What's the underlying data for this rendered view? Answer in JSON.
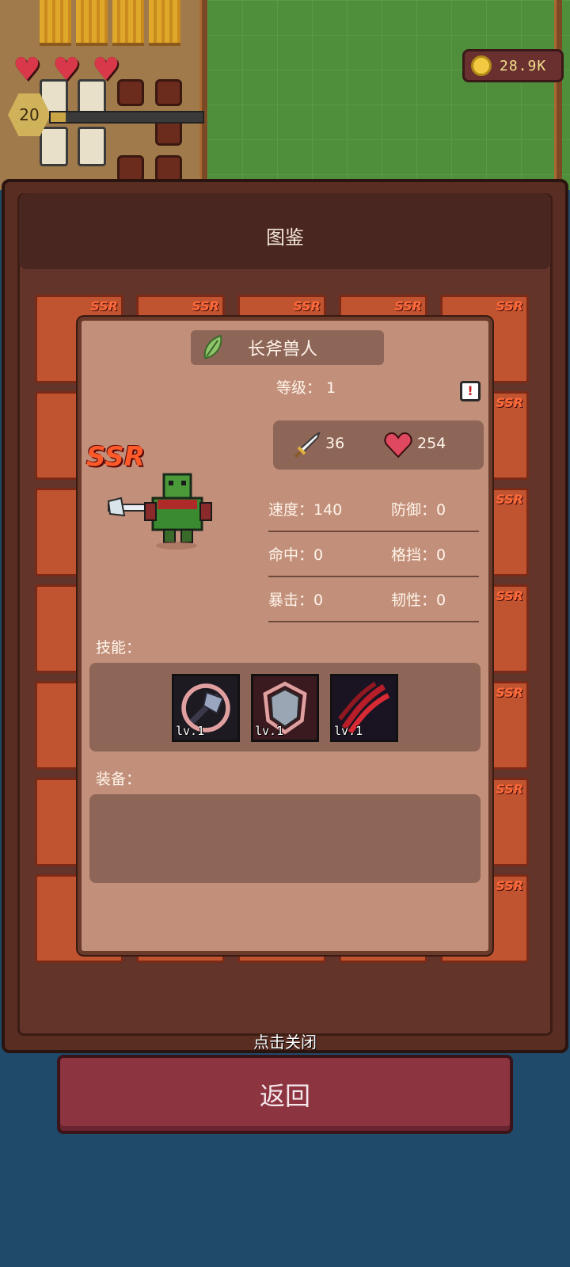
{
  "hud": {
    "hearts": 3,
    "level": "20",
    "xp_progress": 0.1,
    "coins": "28.9K"
  },
  "codex": {
    "title": "图鉴",
    "card_tag": "SSR"
  },
  "hero": {
    "rarity": "SSR",
    "name": "长斧兽人",
    "level_label": "等级：",
    "level_value": "1",
    "attack": "36",
    "hp": "254",
    "stats": [
      {
        "left": "速度：140",
        "right": "防御：0"
      },
      {
        "left": "命中：0",
        "right": "格挡：0"
      },
      {
        "left": "暴击：0",
        "right": "韧性：0"
      }
    ],
    "skills_label": "技能：",
    "skills": [
      {
        "icon": "axe-skill-icon",
        "level": "lv.1"
      },
      {
        "icon": "shield-skill-icon",
        "level": "lv.1"
      },
      {
        "icon": "claw-skill-icon",
        "level": "lv.1"
      }
    ],
    "equipment_label": "装备："
  },
  "close_hint": "点击关闭",
  "back_button": "返回",
  "colors": {
    "panel": "#5a2d22",
    "card": "#c05330",
    "popup": "#c2907a",
    "back_button": "#8c3440",
    "ssr": "#ff5a2a"
  }
}
